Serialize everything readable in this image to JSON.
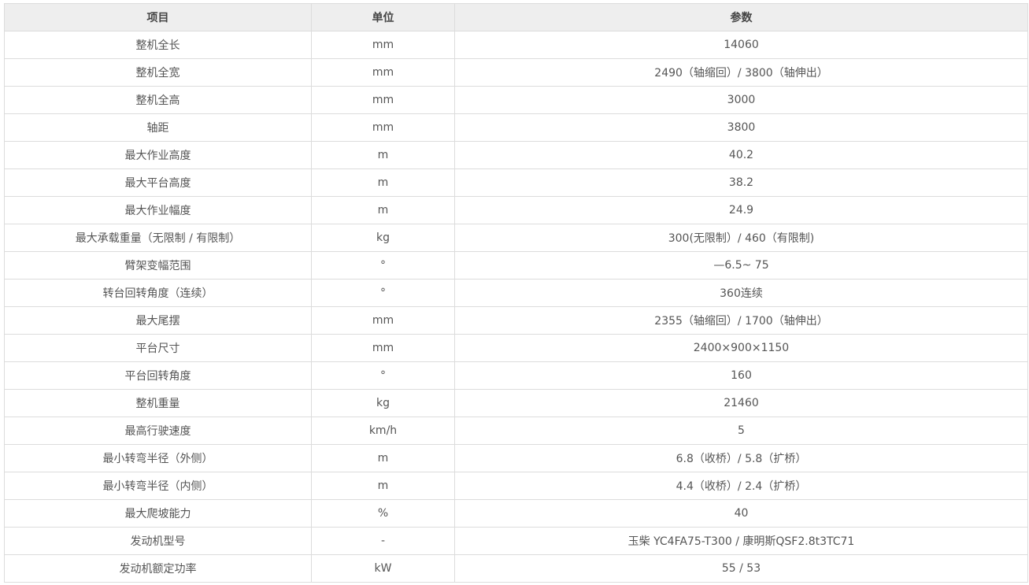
{
  "table": {
    "headers": [
      "项目",
      "单位",
      "参数"
    ],
    "rows": [
      [
        "整机全长",
        "mm",
        "14060"
      ],
      [
        "整机全宽",
        "mm",
        "2490（轴缩回）/ 3800（轴伸出）"
      ],
      [
        "整机全高",
        "mm",
        "3000"
      ],
      [
        "轴距",
        "mm",
        "3800"
      ],
      [
        "最大作业高度",
        "m",
        "40.2"
      ],
      [
        "最大平台高度",
        "m",
        "38.2"
      ],
      [
        "最大作业幅度",
        "m",
        "24.9"
      ],
      [
        "最大承载重量（无限制 / 有限制）",
        "kg",
        "300(无限制）/ 460（有限制)"
      ],
      [
        "臂架变幅范围",
        "°",
        "—6.5~ 75"
      ],
      [
        "转台回转角度（连续）",
        "°",
        "360连续"
      ],
      [
        "最大尾摆",
        "mm",
        "2355（轴缩回）/ 1700（轴伸出）"
      ],
      [
        "平台尺寸",
        "mm",
        "2400×900×1150"
      ],
      [
        "平台回转角度",
        "°",
        "160"
      ],
      [
        "整机重量",
        "kg",
        "21460"
      ],
      [
        "最高行驶速度",
        "km/h",
        "5"
      ],
      [
        "最小转弯半径（外侧）",
        "m",
        "6.8（收桥）/ 5.8（扩桥）"
      ],
      [
        "最小转弯半径（内侧）",
        "m",
        "4.4（收桥）/ 2.4（扩桥）"
      ],
      [
        "最大爬坡能力",
        "%",
        "40"
      ],
      [
        "发动机型号",
        "-",
        "玉柴 YC4FA75-T300 / 康明斯QSF2.8t3TC71"
      ],
      [
        "发动机额定功率",
        "kW",
        "55 / 53"
      ]
    ]
  }
}
